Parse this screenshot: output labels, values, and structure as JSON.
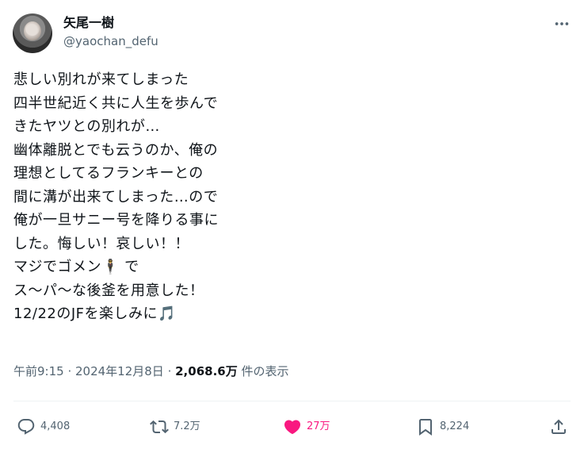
{
  "author": {
    "name": "矢尾一樹",
    "handle": "@yaochan_defu"
  },
  "post": {
    "lines": [
      "悲しい別れが来てしまった",
      "四半世紀近く共に人生を歩んで",
      "きたヤツとの別れが…",
      "幽体離脱とでも云うのか、俺の",
      "理想としてるフランキーとの",
      "間に溝が出来てしまった…ので",
      "俺が一旦サニー号を降りる事に",
      "した。悔しい！哀しい！！",
      "マジでゴメン🕴 で",
      "ス～パ～な後釜を用意した！",
      "12/22のJFを楽しみに🎵"
    ]
  },
  "meta": {
    "time": "午前9:15",
    "separator1": " · ",
    "date": "2024年12月8日",
    "separator2": " · ",
    "views_count": "2,068.6万",
    "views_label": " 件の表示"
  },
  "actions": {
    "reply_count": "4,408",
    "repost_count": "7.2万",
    "like_count": "27万",
    "bookmark_count": "8,224"
  },
  "colors": {
    "like": "#f91880",
    "muted": "#536471",
    "text": "#0f1419"
  },
  "icons": {
    "more": "more-icon",
    "reply": "reply-icon",
    "repost": "repost-icon",
    "like": "heart-icon",
    "bookmark": "bookmark-icon",
    "share": "share-icon"
  }
}
